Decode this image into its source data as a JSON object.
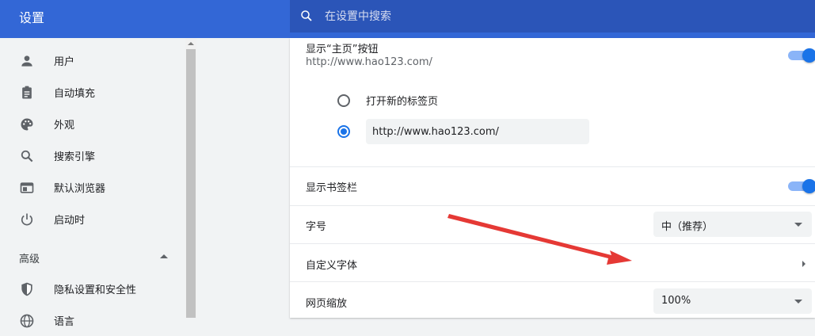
{
  "header": {
    "title": "设置",
    "search_placeholder": "在设置中搜索"
  },
  "sidebar": {
    "items": [
      {
        "label": "用户",
        "icon": "person-icon"
      },
      {
        "label": "自动填充",
        "icon": "clipboard-icon"
      },
      {
        "label": "外观",
        "icon": "palette-icon"
      },
      {
        "label": "搜索引擎",
        "icon": "search-icon"
      },
      {
        "label": "默认浏览器",
        "icon": "browser-icon"
      },
      {
        "label": "启动时",
        "icon": "power-icon"
      }
    ],
    "advanced_label": "高级",
    "advanced_items": [
      {
        "label": "隐私设置和安全性",
        "icon": "shield-icon"
      },
      {
        "label": "语言",
        "icon": "globe-icon"
      }
    ]
  },
  "main": {
    "home_button": {
      "title": "显示“主页”按钮",
      "subtitle": "http://www.hao123.com/",
      "enabled": true,
      "options": [
        {
          "label": "打开新的标签页",
          "selected": false
        },
        {
          "value": "http://www.hao123.com/",
          "selected": true
        }
      ]
    },
    "bookmarks_bar": {
      "title": "显示书签栏",
      "enabled": true
    },
    "font_size": {
      "title": "字号",
      "value": "中（推荐）"
    },
    "custom_fonts": {
      "title": "自定义字体"
    },
    "page_zoom": {
      "title": "网页缩放",
      "value": "100%"
    }
  },
  "colors": {
    "header": "#3367d6",
    "accent": "#1a73e8",
    "annotation_arrow": "#e53935"
  }
}
